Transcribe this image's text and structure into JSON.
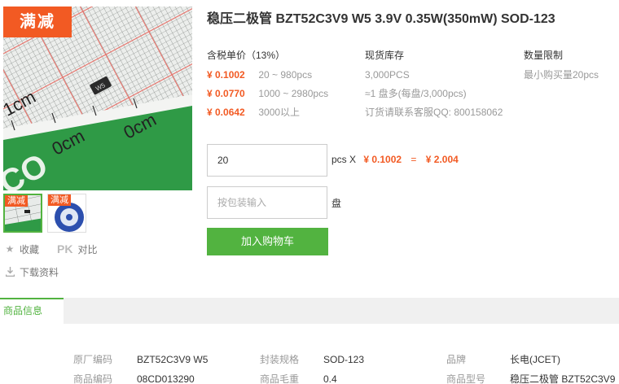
{
  "promo": {
    "tag": "满减",
    "thumb_tags": [
      "满减",
      "满减"
    ]
  },
  "side": {
    "favorite": "收藏",
    "pk_badge": "PK",
    "compare": "对比",
    "download": "下载资料"
  },
  "product": {
    "title": "稳压二极管 BZT52C3V9 W5 3.9V 0.35W(350mW) SOD-123"
  },
  "pricing": {
    "header": "含税单价（13%）",
    "tiers": [
      {
        "price": "¥ 0.1002",
        "range": "20 ~ 980pcs"
      },
      {
        "price": "¥ 0.0770",
        "range": "1000 ~ 2980pcs"
      },
      {
        "price": "¥ 0.0642",
        "range": "3000以上"
      }
    ]
  },
  "stock": {
    "header": "现货库存",
    "lines": [
      "3,000PCS",
      "≈1 盘多(每盘/3,000pcs)",
      "订货请联系客服QQ: 800158062"
    ]
  },
  "limit": {
    "header": "数量限制",
    "lines": [
      "最小购买量20pcs"
    ]
  },
  "order": {
    "qty_value": "20",
    "unit_label": "pcs X",
    "unit_price": "¥ 0.1002",
    "equals": "=",
    "total": "¥ 2.004",
    "reel_placeholder": "按包装输入",
    "reel_unit": "盘",
    "add_to_cart": "加入购物车"
  },
  "info": {
    "tab_label": "商品信息",
    "rows": [
      [
        {
          "key": "原厂编码",
          "value": "BZT52C3V9 W5"
        },
        {
          "key": "封装规格",
          "value": "SOD-123"
        },
        {
          "key": "品牌",
          "value": "长电(JCET)"
        }
      ],
      [
        {
          "key": "商品编码",
          "value": "08CD013290"
        },
        {
          "key": "商品毛重",
          "value": "0.4"
        },
        {
          "key": "商品型号",
          "value": "稳压二极管 BZT52C3V9"
        }
      ]
    ]
  },
  "image_labels": {
    "ruler_1cm": "1cm",
    "ruler_0cm_a": "0cm",
    "ruler_0cm_b": "0cm",
    "logo_text": "CO",
    "part_mark": "W5"
  },
  "colors": {
    "accent_green": "#52b340",
    "price_orange": "#f25a23"
  }
}
